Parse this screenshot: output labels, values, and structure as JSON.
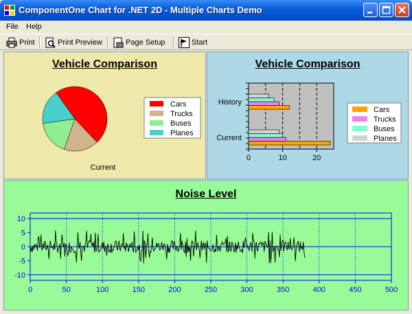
{
  "window": {
    "title": "ComponentOne Chart for .NET 2D - Multiple Charts Demo"
  },
  "menu": [
    {
      "label": "File"
    },
    {
      "label": "Help"
    }
  ],
  "toolbar": {
    "print": "Print",
    "print_preview": "Print Preview",
    "page_setup": "Page Setup",
    "start": "Start"
  },
  "colors": {
    "cars": "#ff0000",
    "trucks": "#d2b48c",
    "buses": "#90ee90",
    "planes": "#48d1cc",
    "bar_cars": "#ffa500",
    "bar_trucks": "#ee82ee",
    "bar_buses": "#7fffd4",
    "bar_planes": "#d3d3d3"
  },
  "chart_data": [
    {
      "type": "pie",
      "title": "Vehicle Comparison",
      "xlabel": "Current",
      "categories": [
        "Cars",
        "Trucks",
        "Buses",
        "Planes"
      ],
      "values": [
        11,
        4,
        4,
        4
      ],
      "legend": [
        "Cars",
        "Trucks",
        "Buses",
        "Planes"
      ],
      "legend_position": "right"
    },
    {
      "type": "bar",
      "orientation": "horizontal",
      "title": "Vehicle Comparison",
      "categories": [
        "Current",
        "History"
      ],
      "series": [
        {
          "name": "Cars",
          "values": [
            24,
            12
          ]
        },
        {
          "name": "Trucks",
          "values": [
            11,
            9
          ]
        },
        {
          "name": "Buses",
          "values": [
            10,
            7.5
          ]
        },
        {
          "name": "Planes",
          "values": [
            9,
            6
          ]
        }
      ],
      "xlim": [
        0,
        25
      ],
      "xticks": [
        0,
        10,
        20
      ],
      "grid": true,
      "legend_position": "right"
    },
    {
      "type": "line",
      "title": "Noise Level",
      "xlim": [
        0,
        500
      ],
      "ylim": [
        -12,
        12
      ],
      "xticks": [
        0,
        50,
        100,
        150,
        200,
        250,
        300,
        350,
        400,
        450,
        500
      ],
      "yticks": [
        10,
        5,
        0,
        -5,
        -10
      ],
      "x_start": 0,
      "x_end": 380,
      "amplitude": 5,
      "grid": true
    }
  ]
}
